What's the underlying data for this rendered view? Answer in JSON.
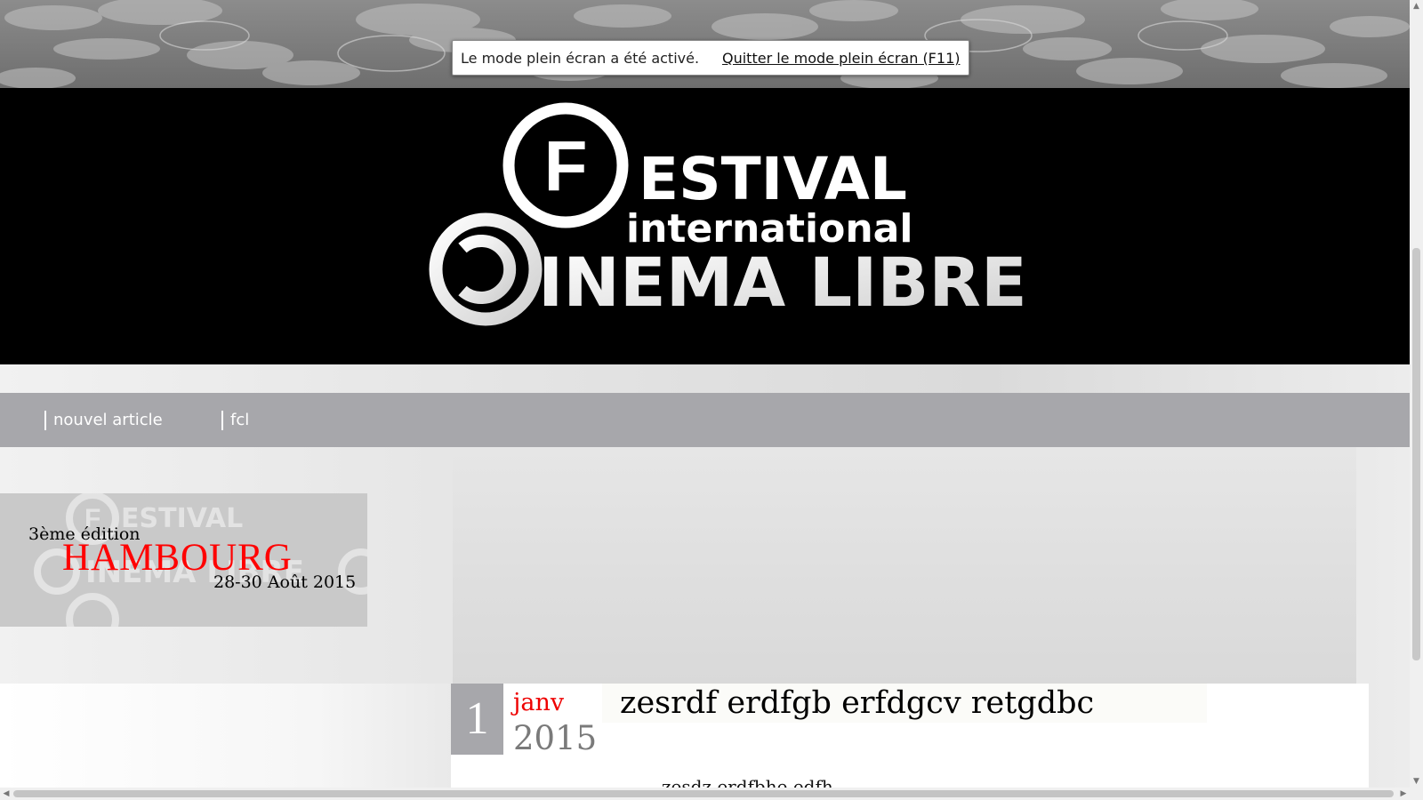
{
  "fullscreen_notice": {
    "message": "Le mode plein écran a été activé.",
    "exit_link": "Quitter le mode plein écran (F11)"
  },
  "banner": {
    "logo_line1_letter": "F",
    "logo_line1": "ESTIVAL",
    "logo_line2": "international",
    "logo_line3": "INEMA LIBRE"
  },
  "nav": {
    "items": [
      {
        "label": "nouvel article"
      },
      {
        "label": "fcl"
      }
    ]
  },
  "promo": {
    "edition": "3ème édition",
    "city": "HAMBOURG",
    "dates": "28-30 Août 2015",
    "background_logo": {
      "line1_letter": "F",
      "line1": "ESTIVAL",
      "line2": "INEMA LIBRE"
    }
  },
  "article": {
    "day": "1",
    "month": "janv",
    "year": "2015",
    "title": "zesrdf erdfgb erfdgcv retgdbc",
    "excerpt": "zesdz erdfbhe edfh"
  },
  "colors": {
    "nav_bg": "#a7a7ab",
    "accent_red": "#ff0000",
    "banner_bg": "#000000"
  },
  "icons": {
    "scroll_up": "arrow-up-icon",
    "scroll_down": "arrow-down-icon",
    "scroll_left": "arrow-left-icon",
    "scroll_right": "arrow-right-icon"
  }
}
